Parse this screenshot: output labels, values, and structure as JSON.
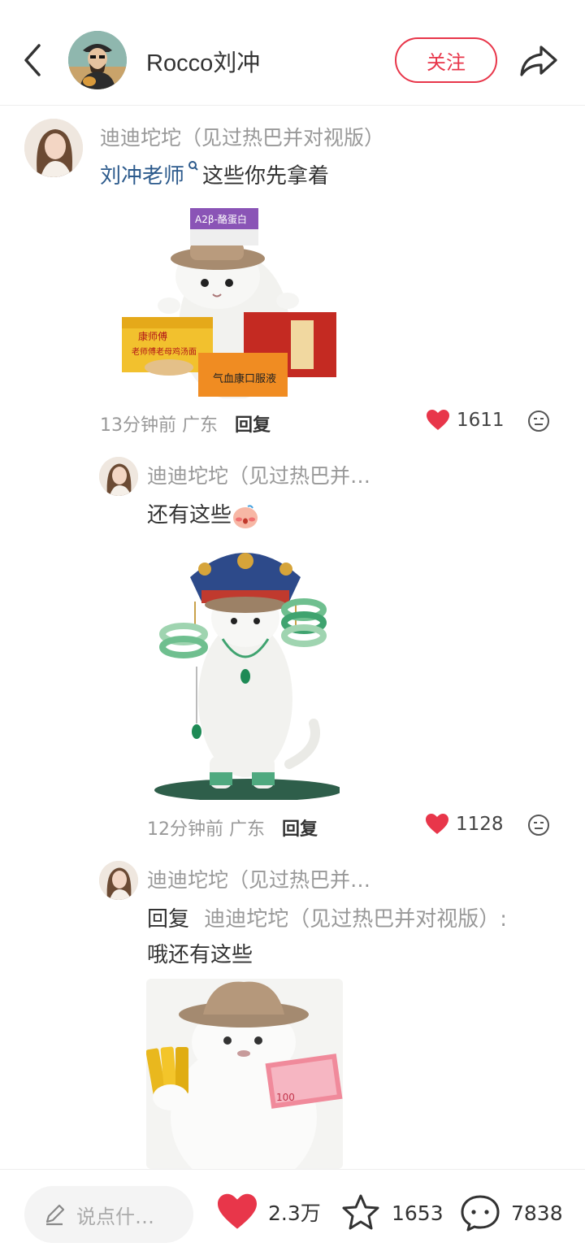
{
  "header": {
    "author_name": "Rocco刘冲",
    "follow_label": "关注"
  },
  "comments": [
    {
      "name": "迪迪坨坨（见过热巴并对视版）",
      "mention": "刘冲老师",
      "text": "这些你先拿着",
      "time": "13分钟前",
      "location": "广东",
      "reply_label": "回复",
      "likes": "1611",
      "image_labels": [
        "A2β-酪蛋白",
        "康师傅",
        "老师傅老母鸡汤面",
        "气血康口服液"
      ]
    },
    {
      "name": "迪迪坨坨（见过热巴并…",
      "text": "还有这些",
      "time": "12分钟前",
      "location": "广东",
      "reply_label": "回复",
      "likes": "1128"
    },
    {
      "name": "迪迪坨坨（见过热巴并…",
      "reply_prefix": "回复",
      "reply_target": "迪迪坨坨（见过热巴并对视版）:",
      "text": "哦还有这些",
      "image_labels": [
        "100"
      ]
    }
  ],
  "bottom_bar": {
    "input_placeholder": "说点什…",
    "likes": "2.3万",
    "collects": "1653",
    "comments": "7838"
  },
  "colors": {
    "accent": "#e8364a",
    "mention": "#2c5a8c",
    "muted": "#999999"
  },
  "icons": [
    "back-arrow-icon",
    "share-icon",
    "heart-icon",
    "emoji-icon",
    "pencil-icon",
    "star-icon",
    "comment-bubble-icon"
  ]
}
